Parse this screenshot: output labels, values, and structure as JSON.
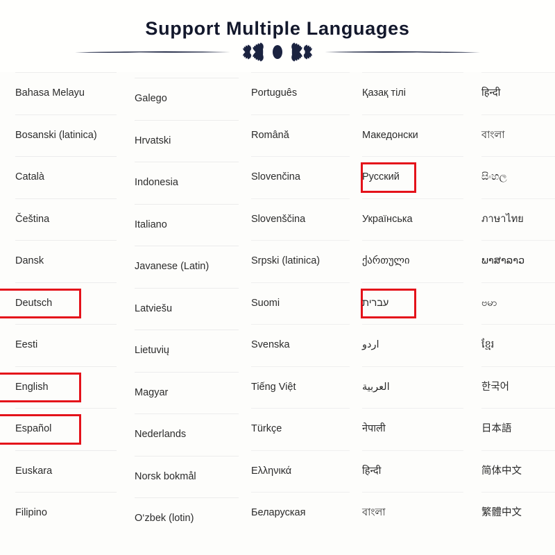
{
  "header": {
    "title": "Support Multiple Languages",
    "title_color": "#13182c",
    "ornament_color": "#1b2340",
    "ornament_name": "decorative-divider"
  },
  "theme": {
    "background": "#fdfdfb",
    "text_color": "#2b2b2b",
    "separator_color": "#ececec",
    "highlight_border_color": "#e4121a"
  },
  "columns": [
    {
      "index": 1,
      "items": [
        {
          "label": "Bahasa Melayu",
          "highlighted": false
        },
        {
          "label": "Bosanski (latinica)",
          "highlighted": false
        },
        {
          "label": "Català",
          "highlighted": false
        },
        {
          "label": "Čeština",
          "highlighted": false
        },
        {
          "label": "Dansk",
          "highlighted": false
        },
        {
          "label": "Deutsch",
          "highlighted": true
        },
        {
          "label": "Eesti",
          "highlighted": false
        },
        {
          "label": "English",
          "highlighted": true
        },
        {
          "label": "Español",
          "highlighted": true
        },
        {
          "label": "Euskara",
          "highlighted": false
        },
        {
          "label": "Filipino",
          "highlighted": false
        }
      ]
    },
    {
      "index": 2,
      "items": [
        {
          "label": "Galego",
          "highlighted": false
        },
        {
          "label": "Hrvatski",
          "highlighted": false
        },
        {
          "label": "Indonesia",
          "highlighted": false
        },
        {
          "label": "Italiano",
          "highlighted": false
        },
        {
          "label": "Javanese (Latin)",
          "highlighted": false
        },
        {
          "label": "Latviešu",
          "highlighted": false
        },
        {
          "label": "Lietuvių",
          "highlighted": false
        },
        {
          "label": "Magyar",
          "highlighted": false
        },
        {
          "label": "Nederlands",
          "highlighted": false
        },
        {
          "label": "Norsk bokmål",
          "highlighted": false
        },
        {
          "label": "O‘zbek (lotin)",
          "highlighted": false
        }
      ]
    },
    {
      "index": 3,
      "items": [
        {
          "label": "Português",
          "highlighted": false
        },
        {
          "label": "Română",
          "highlighted": false
        },
        {
          "label": "Slovenčina",
          "highlighted": false
        },
        {
          "label": "Slovenščina",
          "highlighted": false
        },
        {
          "label": "Srpski (latinica)",
          "highlighted": false
        },
        {
          "label": "Suomi",
          "highlighted": false
        },
        {
          "label": "Svenska",
          "highlighted": false
        },
        {
          "label": "Tiếng Việt",
          "highlighted": false
        },
        {
          "label": "Türkçe",
          "highlighted": false
        },
        {
          "label": "Ελληνικά",
          "highlighted": false
        },
        {
          "label": "Беларуская",
          "highlighted": false
        }
      ]
    },
    {
      "index": 4,
      "items": [
        {
          "label": "Қазақ тілі",
          "highlighted": false
        },
        {
          "label": "Македонски",
          "highlighted": false
        },
        {
          "label": "Русский",
          "highlighted": true
        },
        {
          "label": "Українська",
          "highlighted": false
        },
        {
          "label": "ქართული",
          "highlighted": false
        },
        {
          "label": "עברית",
          "highlighted": true,
          "rtl": true
        },
        {
          "label": "اردو",
          "highlighted": false,
          "rtl": true
        },
        {
          "label": "العربية",
          "highlighted": false,
          "rtl": true
        },
        {
          "label": "नेपाली",
          "highlighted": false
        },
        {
          "label": "हिन्दी",
          "highlighted": false
        },
        {
          "label": "বাংলা",
          "highlighted": false
        }
      ]
    },
    {
      "index": 5,
      "items": [
        {
          "label": "हिन्दी",
          "highlighted": false
        },
        {
          "label": "বাংলা",
          "highlighted": false
        },
        {
          "label": "සිංහල",
          "highlighted": false
        },
        {
          "label": "ภาษาไทย",
          "highlighted": false
        },
        {
          "label": "ພາສາລາວ",
          "highlighted": false
        },
        {
          "label": "ဗမာ",
          "highlighted": false
        },
        {
          "label": "ខ្មែរ",
          "highlighted": false
        },
        {
          "label": "한국어",
          "highlighted": false
        },
        {
          "label": "日本語",
          "highlighted": false
        },
        {
          "label": "简体中文",
          "highlighted": false
        },
        {
          "label": "繁體中文",
          "highlighted": false
        }
      ]
    }
  ]
}
